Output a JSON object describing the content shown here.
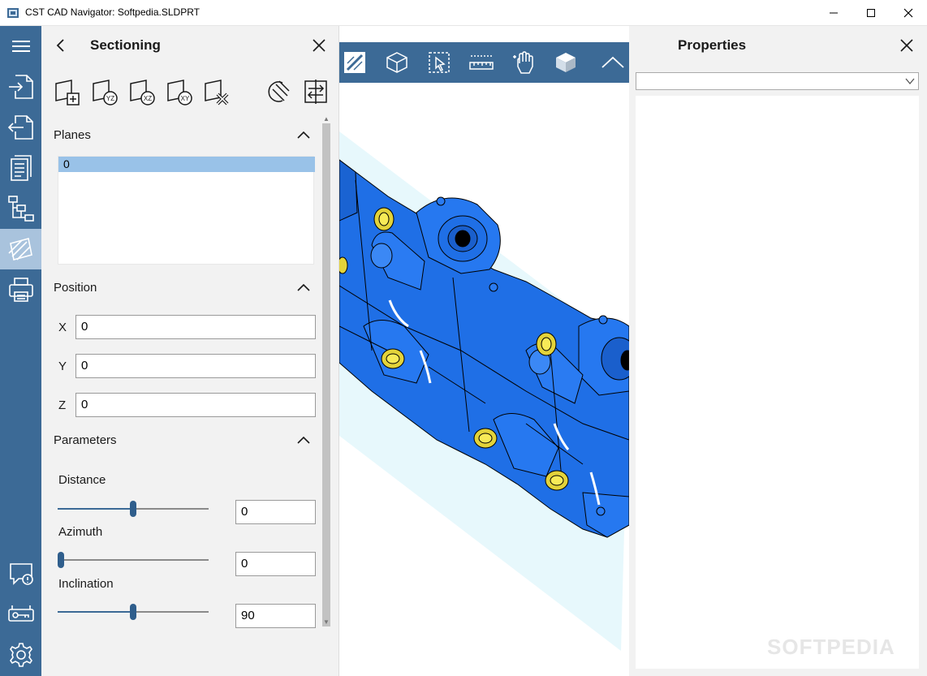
{
  "window": {
    "title": "CST CAD Navigator: Softpedia.SLDPRT"
  },
  "rail": {
    "items": [
      "menu-icon",
      "import-icon",
      "export-icon",
      "document-icon",
      "hierarchy-icon",
      "sectioning-icon",
      "print-icon",
      "feedback-icon",
      "license-key-icon",
      "settings-icon"
    ],
    "active": "sectioning-icon"
  },
  "sectioning": {
    "title": "Sectioning",
    "planes": {
      "title": "Planes",
      "items": [
        "0"
      ]
    },
    "position": {
      "title": "Position",
      "x_label": "X",
      "x_value": "0",
      "y_label": "Y",
      "y_value": "0",
      "z_label": "Z",
      "z_value": "0"
    },
    "parameters": {
      "title": "Parameters",
      "distance_label": "Distance",
      "distance_value": "0",
      "distance_level": 0.5,
      "azimuth_label": "Azimuth",
      "azimuth_value": "0",
      "azimuth_level": 0.0,
      "inclination_label": "Inclination",
      "inclination_value": "90",
      "inclination_level": 0.5
    }
  },
  "properties": {
    "title": "Properties",
    "selected": ""
  },
  "watermark": "SOFTPEDIA",
  "colors": {
    "accent": "#3c6a96",
    "model": "#1f6fe6",
    "highlight": "#99c2e8"
  }
}
